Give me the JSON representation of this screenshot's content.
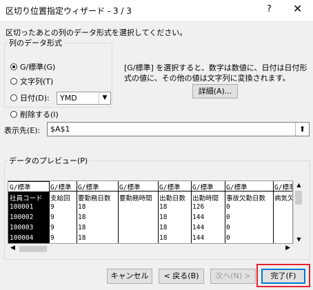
{
  "window": {
    "title": "区切り位置指定ウィザード - 3 / 3",
    "help_label": "?",
    "close_label": "✕"
  },
  "instruction": "区切ったあとの列のデータ形式を選択してください。",
  "format_group": {
    "legend": "列のデータ形式",
    "options": [
      "G/標準(G)",
      "文字列(T)",
      "日付(D):",
      "削除する(I)"
    ],
    "selected": "G/標準(G)",
    "date_format": "YMD"
  },
  "description": "[G/標準] を選択すると、数字は数値に、日付は日付形式の値に、その他の値は文字列に変換されます。",
  "advanced_button": "詳細(A)...",
  "destination": {
    "label": "表示先(E):",
    "value": "$A$1"
  },
  "preview": {
    "legend": "データのプレビュー(P)",
    "columns": [
      {
        "header": "G/標準",
        "rows": [
          "社員コード",
          "100001",
          "100002",
          "100003",
          "100004"
        ]
      },
      {
        "header": "G/標準",
        "rows": [
          "支給回",
          "9",
          "9",
          "9",
          "9"
        ]
      },
      {
        "header": "G/標準",
        "rows": [
          "要勤務日数",
          "18",
          "18",
          "18",
          "18"
        ]
      },
      {
        "header": "G/標準",
        "rows": [
          "要勤務時間",
          "",
          "",
          "",
          ""
        ]
      },
      {
        "header": "G/標準",
        "rows": [
          "出勤日数",
          "18",
          "18",
          "18",
          "18"
        ]
      },
      {
        "header": "G/標準",
        "rows": [
          "出勤時間",
          "126",
          "144",
          "144",
          "144"
        ]
      },
      {
        "header": "G/標準",
        "rows": [
          "事故欠勤日数",
          "0",
          "0",
          "0",
          "0"
        ]
      },
      {
        "header": "G/標準",
        "rows": [
          "病気欠",
          "",
          "",
          "",
          ""
        ]
      }
    ]
  },
  "buttons": {
    "cancel": "キャンセル",
    "back": "< 戻る(B)",
    "next": "次へ(N) >",
    "finish": "完了(F)"
  }
}
